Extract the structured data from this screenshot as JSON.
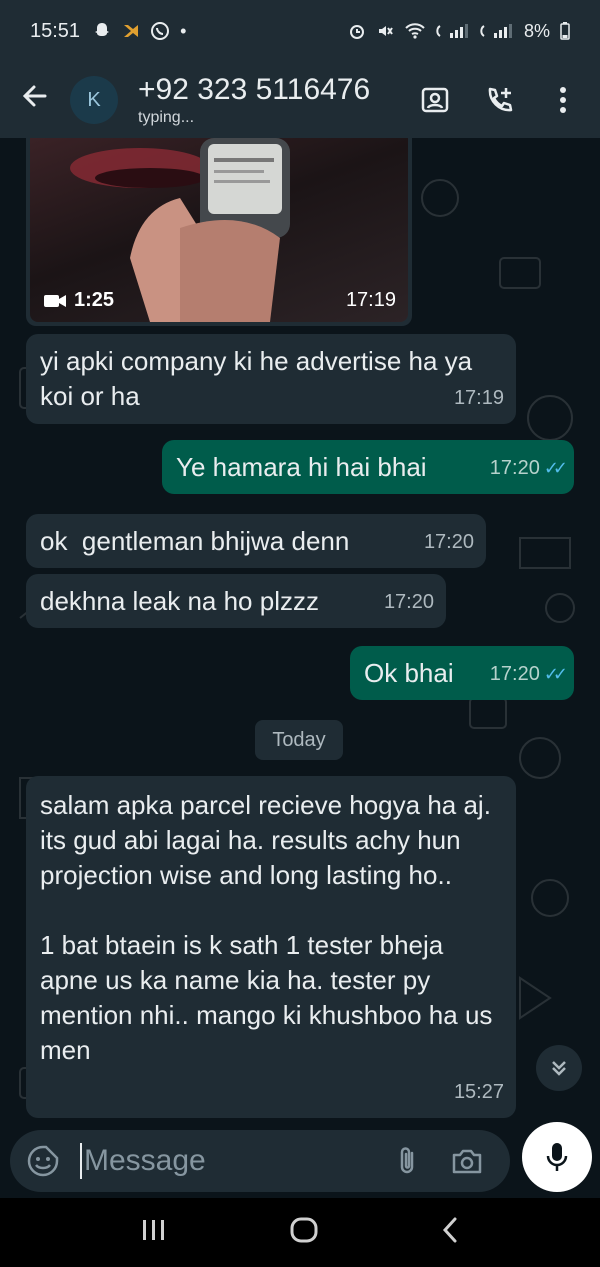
{
  "status_bar": {
    "time": "15:51",
    "battery": "8%"
  },
  "header": {
    "avatar_letter": "K",
    "contact_name": "+92 323 5116476",
    "contact_status": "typing..."
  },
  "video_message": {
    "duration": "1:25",
    "time": "17:19"
  },
  "messages": [
    {
      "direction": "in",
      "text": "yi apki company ki he advertise ha ya koi or ha",
      "time": "17:19"
    },
    {
      "direction": "out",
      "text": "Ye hamara hi hai bhai",
      "time": "17:20"
    },
    {
      "direction": "in",
      "text": "ok  gentleman bhijwa denn",
      "time": "17:20"
    },
    {
      "direction": "in",
      "text": "dekhna leak na ho plzzz",
      "time": "17:20"
    },
    {
      "direction": "out",
      "text": "Ok bhai",
      "time": "17:20"
    },
    {
      "direction": "in",
      "text": "salam apka parcel recieve hogya ha aj. its gud abi lagai ha. results achy hun projection wise and long lasting ho..\n\n1 bat btaein is k sath 1 tester bheja apne us ka name kia ha. tester py mention nhi..  mango ki khushboo ha us men",
      "time": "15:27"
    }
  ],
  "date_separator": "Today",
  "composer": {
    "placeholder": "Message"
  },
  "colors": {
    "header_bg": "#1f2c34",
    "chat_bg": "#0b141a",
    "incoming_bubble": "#1f2c34",
    "outgoing_bubble": "#005c4b",
    "read_ticks": "#53bdeb"
  }
}
